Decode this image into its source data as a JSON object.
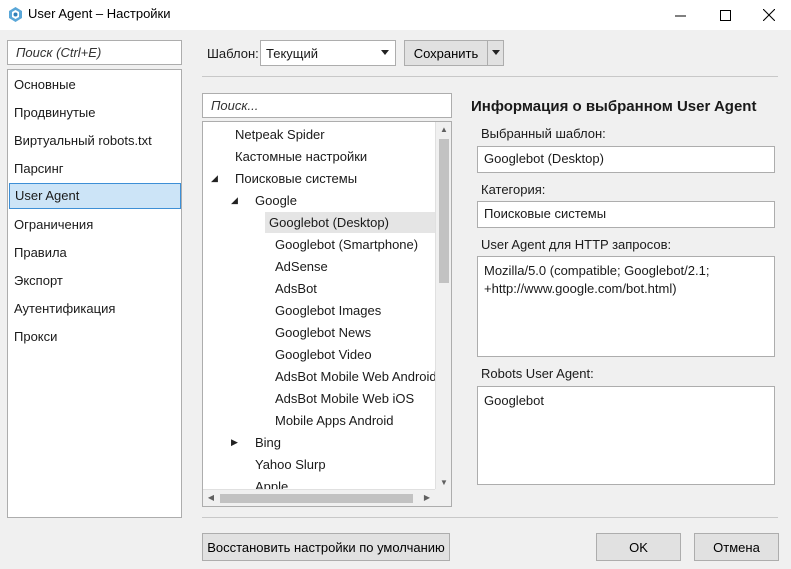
{
  "window": {
    "title": "User Agent – Настройки"
  },
  "sidebar": {
    "search_placeholder": "Поиск (Ctrl+E)",
    "items": [
      {
        "label": "Основные"
      },
      {
        "label": "Продвинутые"
      },
      {
        "label": "Виртуальный robots.txt"
      },
      {
        "label": "Парсинг"
      },
      {
        "label": "User Agent",
        "selected": true
      },
      {
        "label": "Ограничения"
      },
      {
        "label": "Правила"
      },
      {
        "label": "Экспорт"
      },
      {
        "label": "Аутентификация"
      },
      {
        "label": "Прокси"
      }
    ]
  },
  "toolbar": {
    "template_label": "Шаблон:",
    "template_value": "Текущий",
    "save_label": "Сохранить"
  },
  "tree": {
    "search_placeholder": "Поиск...",
    "items": [
      {
        "label": "Netpeak Spider"
      },
      {
        "label": "Кастомные настройки"
      },
      {
        "label": "Поисковые системы",
        "expanded": true
      },
      {
        "label": "Google",
        "expanded": true
      },
      {
        "label": "Googlebot (Desktop)",
        "selected": true
      },
      {
        "label": "Googlebot (Smartphone)"
      },
      {
        "label": "AdSense"
      },
      {
        "label": "AdsBot"
      },
      {
        "label": "Googlebot Images"
      },
      {
        "label": "Googlebot News"
      },
      {
        "label": "Googlebot Video"
      },
      {
        "label": "AdsBot Mobile Web Android"
      },
      {
        "label": "AdsBot Mobile Web iOS"
      },
      {
        "label": "Mobile Apps Android"
      },
      {
        "label": "Bing",
        "expanded": false
      },
      {
        "label": "Yahoo Slurp"
      },
      {
        "label": "Apple"
      }
    ]
  },
  "info": {
    "heading": "Информация о выбранном User Agent",
    "template_label": "Выбранный шаблон:",
    "template_value": "Googlebot (Desktop)",
    "category_label": "Категория:",
    "category_value": "Поисковые системы",
    "http_label": "User Agent для HTTP запросов:",
    "http_value": "Mozilla/5.0 (compatible; Googlebot/2.1; +http://www.google.com/bot.html)",
    "robots_label": "Robots User Agent:",
    "robots_value": "Googlebot"
  },
  "footer": {
    "restore_label": "Восстановить настройки по умолчанию",
    "ok_label": "OK",
    "cancel_label": "Отмена"
  },
  "colors": {
    "selection_bg": "#cce4f7",
    "selection_border": "#3d8fd6",
    "window_bg": "#f0f0f0"
  }
}
